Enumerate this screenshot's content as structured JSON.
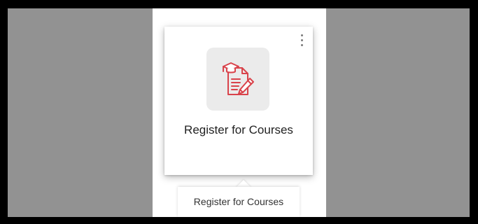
{
  "tile": {
    "label": "Register for Courses",
    "icon": "course-registration-icon",
    "icon_color": "#d9434b",
    "menu_icon": "more-vertical-icon"
  },
  "tooltip": {
    "text": "Register for Courses"
  },
  "colors": {
    "backdrop": "#929292",
    "border": "#000000",
    "icon_bg": "#ebebeb"
  }
}
